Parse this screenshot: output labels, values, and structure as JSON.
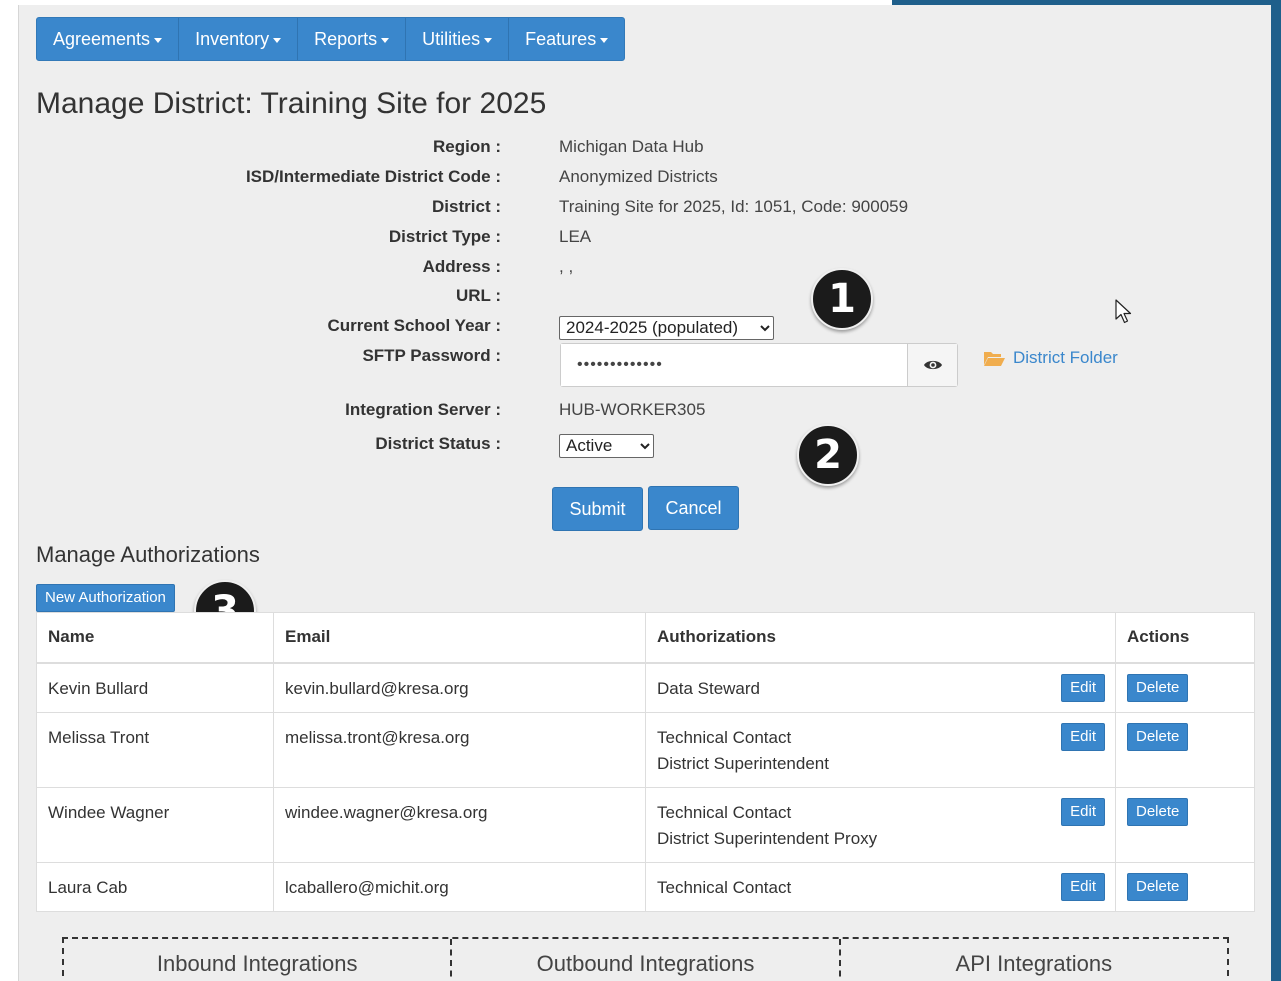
{
  "nav": {
    "items": [
      {
        "label": "Agreements"
      },
      {
        "label": "Inventory"
      },
      {
        "label": "Reports"
      },
      {
        "label": "Utilities"
      },
      {
        "label": "Features"
      }
    ]
  },
  "page": {
    "title": "Manage District: Training Site for 2025"
  },
  "district": {
    "region_label": "Region :",
    "region_value": "Michigan Data Hub",
    "isd_label": "ISD/Intermediate District Code :",
    "isd_value": "Anonymized Districts",
    "district_label": "District :",
    "district_value": "Training Site for 2025, Id: 1051, Code: 900059",
    "type_label": "District Type :",
    "type_value": "LEA",
    "address_label": "Address :",
    "address_value": ", ,",
    "url_label": "URL :",
    "url_value": "",
    "school_year_label": "Current School Year :",
    "school_year_value": "2024-2025 (populated)",
    "sftp_label": "SFTP Password :",
    "sftp_value": "•••••••••••••",
    "district_folder_label": "District Folder",
    "integration_label": "Integration Server :",
    "integration_value": "HUB-WORKER305",
    "status_label": "District Status :",
    "status_value": "Active"
  },
  "form_buttons": {
    "submit": "Submit",
    "cancel": "Cancel"
  },
  "callouts": [
    "1",
    "2",
    "3"
  ],
  "authorizations": {
    "title": "Manage Authorizations",
    "new_button": "New Authorization",
    "columns": [
      "Name",
      "Email",
      "Authorizations",
      "Actions"
    ],
    "edit_label": "Edit",
    "delete_label": "Delete",
    "rows": [
      {
        "name": "Kevin Bullard",
        "email": "kevin.bullard@kresa.org",
        "auth1": "Data Steward",
        "auth2": ""
      },
      {
        "name": "Melissa Tront",
        "email": "melissa.tront@kresa.org",
        "auth1": "Technical Contact",
        "auth2": "District Superintendent"
      },
      {
        "name": "Windee Wagner",
        "email": "windee.wagner@kresa.org",
        "auth1": "Technical Contact",
        "auth2": "District Superintendent Proxy"
      },
      {
        "name": "Laura Cab",
        "email": "lcaballero@michit.org",
        "auth1": "Technical Contact",
        "auth2": ""
      }
    ]
  },
  "tabs": [
    {
      "label": "Inbound Integrations"
    },
    {
      "label": "Outbound Integrations"
    },
    {
      "label": "API Integrations"
    }
  ],
  "colors": {
    "primary": "#3a87cc",
    "panel_bg": "#eeeeee",
    "frame_accent": "#1f5f8b",
    "callout_bg": "#1b1b1b",
    "folder_icon": "#f0ad4e"
  }
}
